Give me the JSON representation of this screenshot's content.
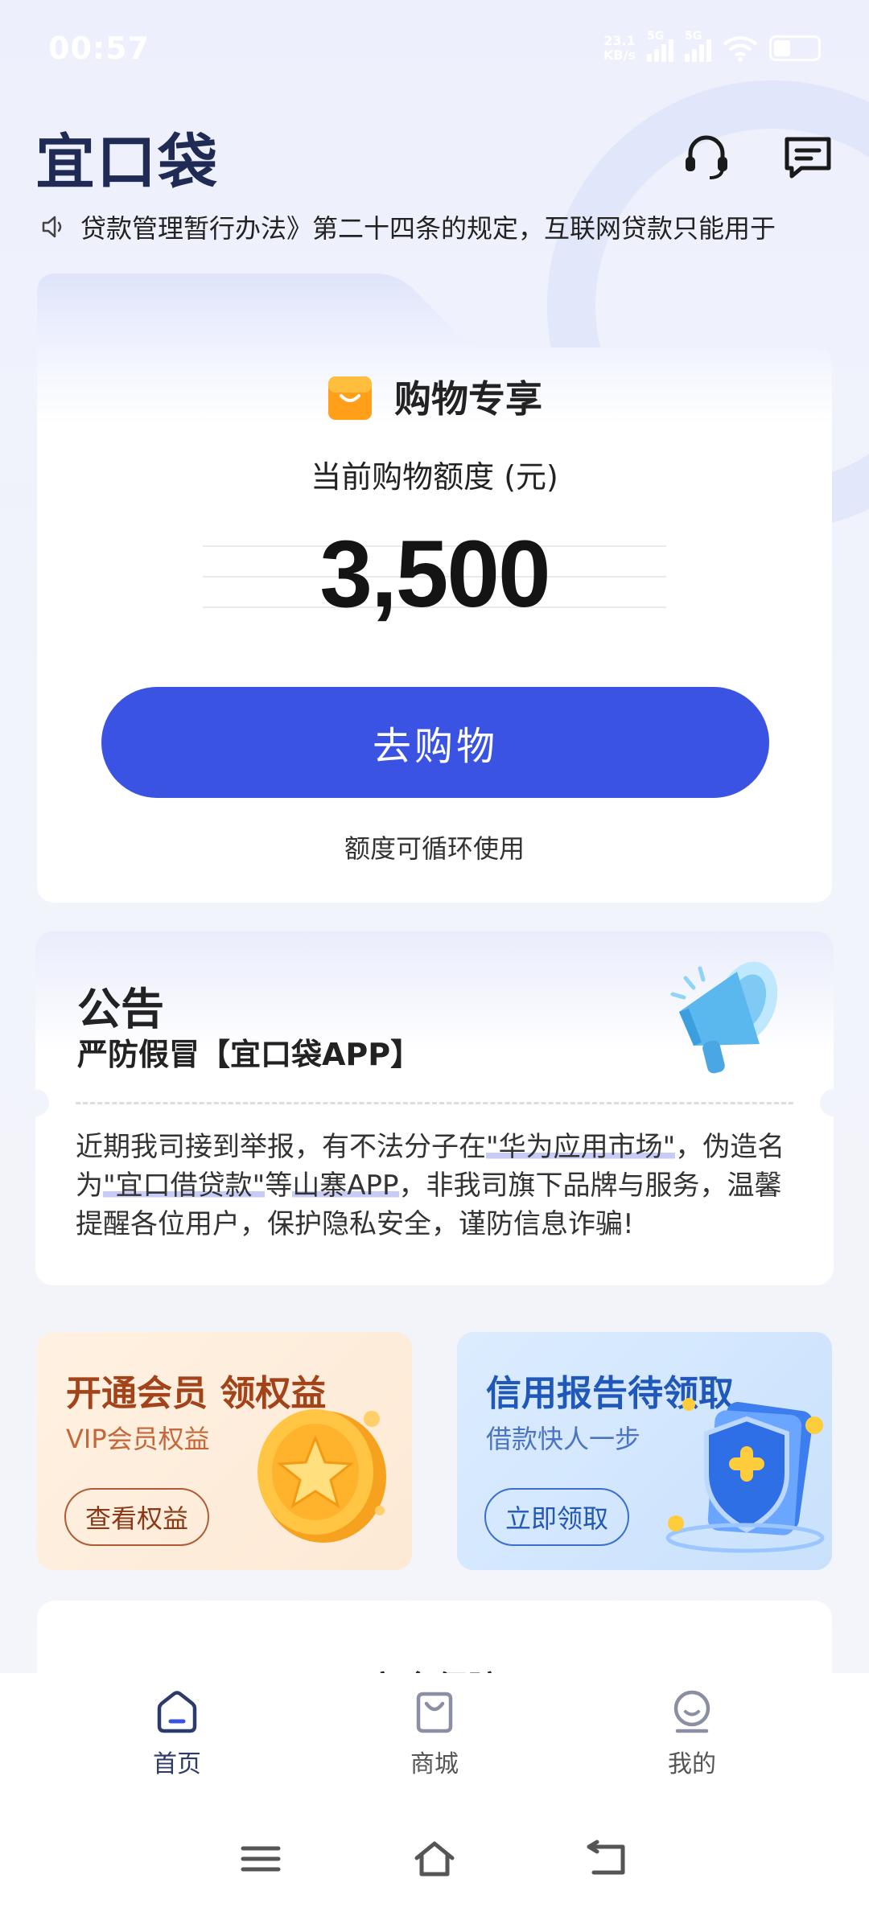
{
  "status_bar": {
    "time": "00:57",
    "net_speed_value": "23.1",
    "net_speed_unit": "KB/s",
    "signal_1_label": "5G",
    "signal_2_label": "5G"
  },
  "header": {
    "logo": "宜口袋",
    "icons": [
      "headset-icon",
      "message-icon"
    ]
  },
  "marquee": {
    "text": "贷款管理暂行办法》第二十四条的规定，互联网贷款只能用于"
  },
  "shopping_card": {
    "title": "购物专享",
    "limit_label": "当前购物额度 (元)",
    "amount": "3,500",
    "button_label": "去购物",
    "note": "额度可循环使用"
  },
  "notice": {
    "title": "公告",
    "subtitle": "严防假冒【宜口袋APP】",
    "body_1": "近期我司接到举报，有不法分子在",
    "hl_1": "\"华为应用市场\"",
    "body_2": "，伪造名为",
    "hl_2": "\"宜口借贷款\"",
    "body_3": "等",
    "hl_3": "山寨APP",
    "body_4": "，非我司旗下品牌与服务，温馨提醒各位用户，保护隐私安全，谨防信息诈骗!"
  },
  "promos": {
    "vip": {
      "title": "开通会员 领权益",
      "subtitle": "VIP会员权益",
      "button": "查看权益"
    },
    "credit": {
      "title": "信用报告待领取",
      "subtitle": "借款快人一步",
      "button": "立即领取"
    }
  },
  "safety": {
    "title": "安全保障"
  },
  "bottom_nav": {
    "items": [
      {
        "label": "首页",
        "icon": "home-icon"
      },
      {
        "label": "商城",
        "icon": "shopping-bag-icon"
      },
      {
        "label": "我的",
        "icon": "profile-icon"
      }
    ]
  },
  "colors": {
    "primary": "#3a53e3",
    "logo": "#1f2a55",
    "vip_title": "#a2431a",
    "credit_title": "#1f58b8"
  }
}
